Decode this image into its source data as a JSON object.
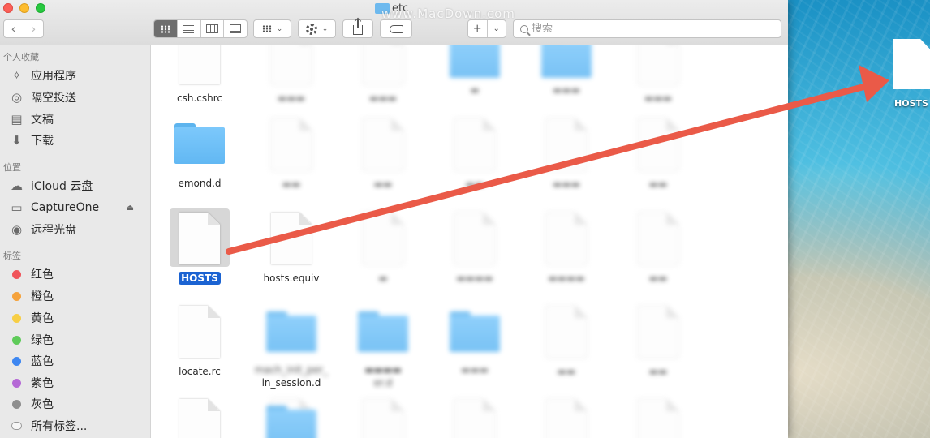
{
  "window": {
    "title": "etc",
    "watermark": "www.MacDown.com"
  },
  "toolbar": {
    "back_icon": "‹",
    "forward_icon": "›",
    "add_label": "+",
    "add_caret": "⌄",
    "search_placeholder": "搜索",
    "arrange_caret": "⌄",
    "action_caret": "⌄"
  },
  "sidebar": {
    "favorites_header": "个人收藏",
    "favorites": [
      {
        "label": "应用程序",
        "icon": "applications-icon"
      },
      {
        "label": "隔空投送",
        "icon": "airdrop-icon"
      },
      {
        "label": "文稿",
        "icon": "documents-icon"
      },
      {
        "label": "下载",
        "icon": "downloads-icon"
      }
    ],
    "locations_header": "位置",
    "locations": [
      {
        "label": "iCloud 云盘",
        "icon": "icloud-icon"
      },
      {
        "label": "CaptureOne",
        "icon": "disk-icon",
        "eject": "⏏"
      },
      {
        "label": "远程光盘",
        "icon": "optical-disc-icon"
      }
    ],
    "tags_header": "标签",
    "tags": [
      {
        "label": "红色",
        "color": "#f0545a"
      },
      {
        "label": "橙色",
        "color": "#f5a23b"
      },
      {
        "label": "黄色",
        "color": "#f7ce45"
      },
      {
        "label": "绿色",
        "color": "#5fcb5a"
      },
      {
        "label": "蓝色",
        "color": "#3e87f1"
      },
      {
        "label": "紫色",
        "color": "#b569d6"
      },
      {
        "label": "灰色",
        "color": "#8e8e8e"
      },
      {
        "label": "所有标签..."
      }
    ]
  },
  "files": {
    "visible_names": [
      "csh.cshrc",
      "emond.d",
      "HOSTS",
      "hosts.equiv",
      "locate.rc",
      "mach_init_per_",
      "in_session.d",
      "er.d"
    ],
    "selected": "HOSTS"
  },
  "desktop": {
    "file_label": "HOSTS"
  },
  "colors": {
    "selection": "#1b63d2",
    "arrow": "#ea5a48",
    "folder": "#6ebdf5"
  }
}
